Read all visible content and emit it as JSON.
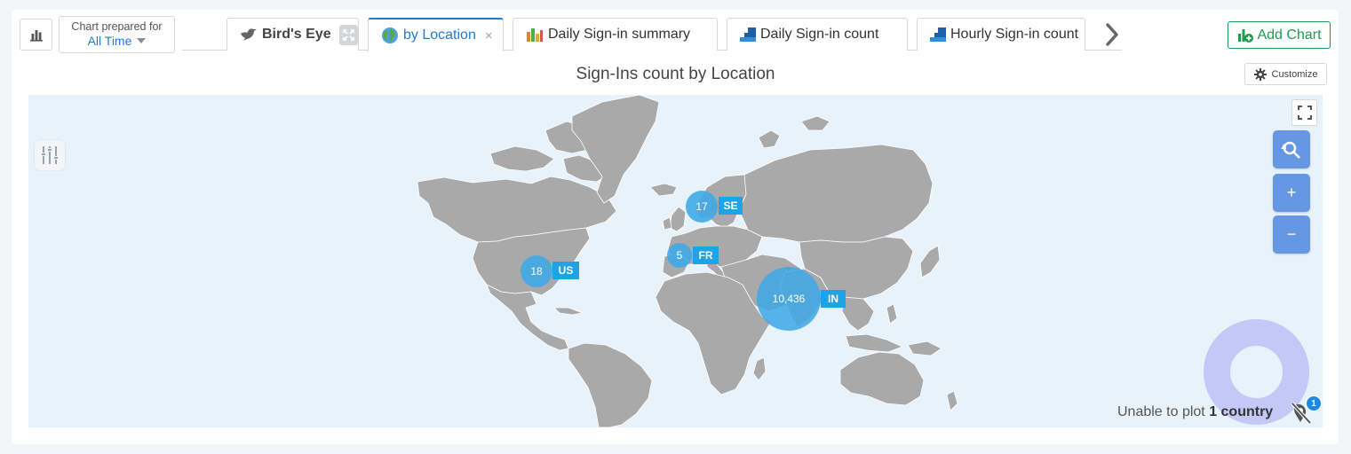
{
  "header": {
    "period_label": "Chart prepared for",
    "period_value": "All Time",
    "add_chart_label": "Add Chart"
  },
  "tabs": [
    {
      "label": "Bird's Eye",
      "icon": "bird-icon",
      "active": false
    },
    {
      "label": "by Location",
      "icon": "globe-icon",
      "active": true
    },
    {
      "label": "Daily Sign-in summary",
      "icon": "bar-chart-icon",
      "active": false
    },
    {
      "label": "Daily Sign-in count",
      "icon": "area-chart-icon",
      "active": false
    },
    {
      "label": "Hourly Sign-in count",
      "icon": "area-chart-icon",
      "active": false
    }
  ],
  "chart": {
    "title": "Sign-Ins count by Location",
    "customize_label": "Customize",
    "zoom_in": "+",
    "zoom_out": "−",
    "locations": [
      {
        "code": "SE",
        "count": "17"
      },
      {
        "code": "FR",
        "count": "5"
      },
      {
        "code": "US",
        "count": "18"
      },
      {
        "code": "IN",
        "count": "10,436"
      }
    ],
    "unplotted": {
      "prefix": "Unable to plot",
      "count_text": "1 country",
      "badge": "1"
    }
  },
  "colors": {
    "accent": "#1e7bd0",
    "add_chart": "#1f9b4e",
    "map_land": "#a9a9a9",
    "map_ocean": "#e7f2fb",
    "bubble": "#3fa9e6",
    "tag": "#1ea4e6",
    "zoom_button": "#6597e2"
  }
}
